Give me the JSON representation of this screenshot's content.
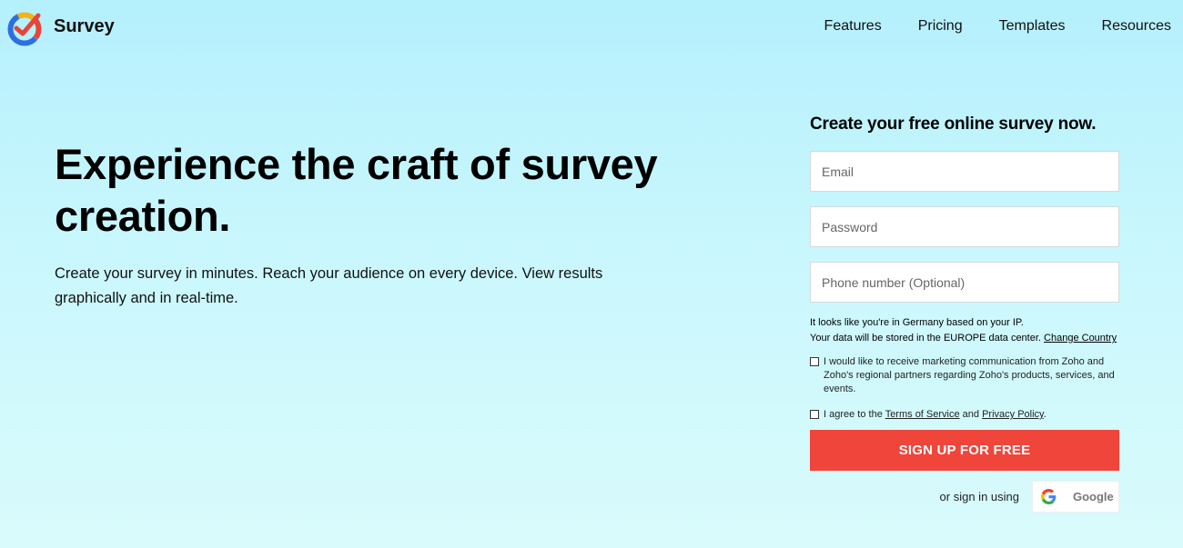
{
  "brand": {
    "name": "Survey"
  },
  "nav": {
    "items": [
      {
        "label": "Features"
      },
      {
        "label": "Pricing"
      },
      {
        "label": "Templates"
      },
      {
        "label": "Resources"
      }
    ]
  },
  "hero": {
    "title": "Experience the craft of survey creation.",
    "subtitle": "Create your survey in minutes. Reach your audience on every device. View results graphically and in real-time."
  },
  "signup": {
    "title": "Create your free online survey now.",
    "email_placeholder": "Email",
    "password_placeholder": "Password",
    "phone_placeholder": "Phone number (Optional)",
    "ip_line1": "It looks like you're in Germany based on your IP.",
    "ip_line2": "Your data will be stored in the EUROPE data center.",
    "change_country": "Change Country",
    "marketing_consent": "I would like to receive marketing communication from Zoho and Zoho's regional partners regarding Zoho's products, services, and events.",
    "terms_prefix": "I agree to the",
    "terms_link": "Terms of Service",
    "terms_and": "and",
    "privacy_link": "Privacy Policy",
    "terms_suffix": ".",
    "button_label": "SIGN UP FOR FREE",
    "alt_signin_label": "or sign in using",
    "google_label": "Google"
  },
  "colors": {
    "accent": "#f0453a",
    "background_top": "#b5f0fd",
    "background_bottom": "#d9fbfc"
  },
  "icons": {
    "logo": "survey-check-logo-icon",
    "google": "google-g-icon"
  }
}
